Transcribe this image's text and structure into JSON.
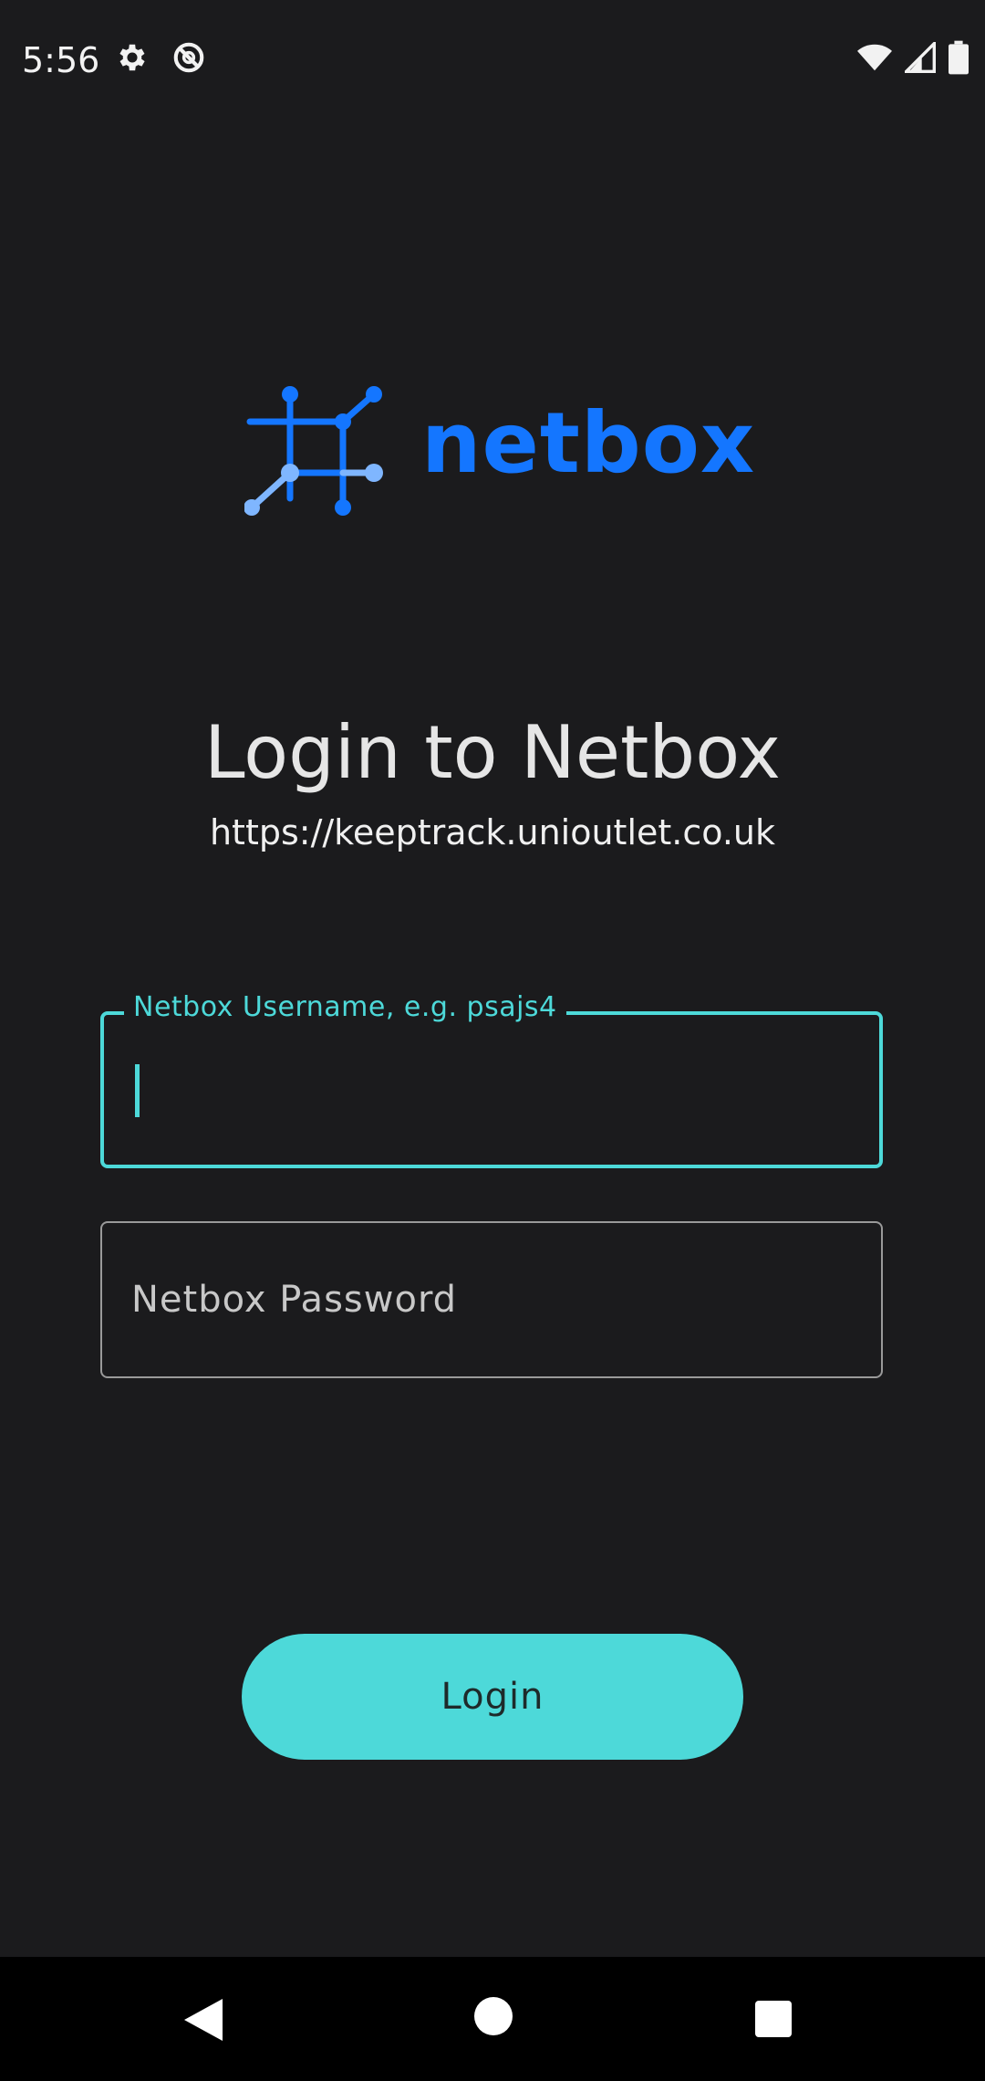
{
  "status_bar": {
    "time": "5:56",
    "left_icons": [
      "gear-icon",
      "do-not-disturb-icon"
    ],
    "right_icons": [
      "wifi-icon",
      "cellular-signal-icon",
      "battery-icon"
    ]
  },
  "logo": {
    "text": "netbox",
    "icon": "netbox-logo-icon",
    "color": "#1476ff"
  },
  "login": {
    "title": "Login to Netbox",
    "server_url": "https://keeptrack.unioutlet.co.uk"
  },
  "form": {
    "username": {
      "label": "Netbox Username, e.g. psajs4",
      "value": ""
    },
    "password": {
      "placeholder": "Netbox Password",
      "value": ""
    },
    "submit_label": "Login"
  },
  "nav_bar": {
    "icons": [
      "back-icon",
      "home-icon",
      "recents-icon"
    ]
  },
  "colors": {
    "background": "#1b1b1d",
    "accent": "#4dd9d9",
    "brand": "#1476ff"
  }
}
